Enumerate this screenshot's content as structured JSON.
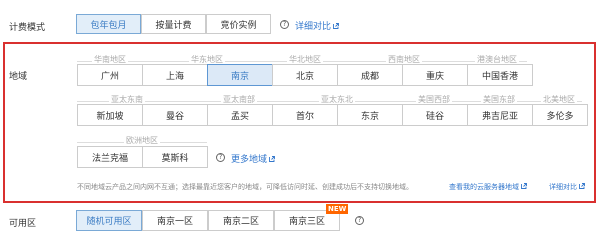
{
  "billing": {
    "label": "计费模式",
    "options": [
      "包年包月",
      "按量计费",
      "竞价实例"
    ],
    "selected": "包年包月",
    "help_link": "详细对比"
  },
  "region": {
    "label": "地域",
    "groups_row1": [
      "华南地区",
      "华东地区",
      "华北地区",
      "西南地区",
      "港澳台地区"
    ],
    "cities_row1": [
      "广州",
      "上海",
      "南京",
      "北京",
      "成都",
      "重庆",
      "中国香港"
    ],
    "selected_city": "南京",
    "groups_row2": [
      "亚太东南",
      "亚太南部",
      "亚太东北",
      "美国西部",
      "美国东部",
      "北美地区"
    ],
    "cities_row2": [
      "新加坡",
      "曼谷",
      "孟买",
      "首尔",
      "东京",
      "硅谷",
      "弗吉尼亚",
      "多伦多"
    ],
    "groups_row3": [
      "欧洲地区"
    ],
    "cities_row3": [
      "法兰克福",
      "莫斯科"
    ],
    "more_link": "更多地域",
    "note": "不同地域云产品之间内网不互通；选择最靠近您客户的地域，可降低访问时延、创建成功后不支持切换地域。",
    "note_link1": "查看我的云服务器地域",
    "note_link2": "详细对比"
  },
  "zone": {
    "label": "可用区",
    "options": [
      "随机可用区",
      "南京一区",
      "南京二区",
      "南京三区"
    ],
    "selected": "随机可用区",
    "new_badge": "NEW"
  },
  "colors": {
    "accent": "#3377cc",
    "selected_bg": "#dce9f7",
    "highlight_border": "#d9302f",
    "badge": "#ff6600"
  },
  "icons": [
    "help-circle-icon",
    "external-link-icon"
  ]
}
